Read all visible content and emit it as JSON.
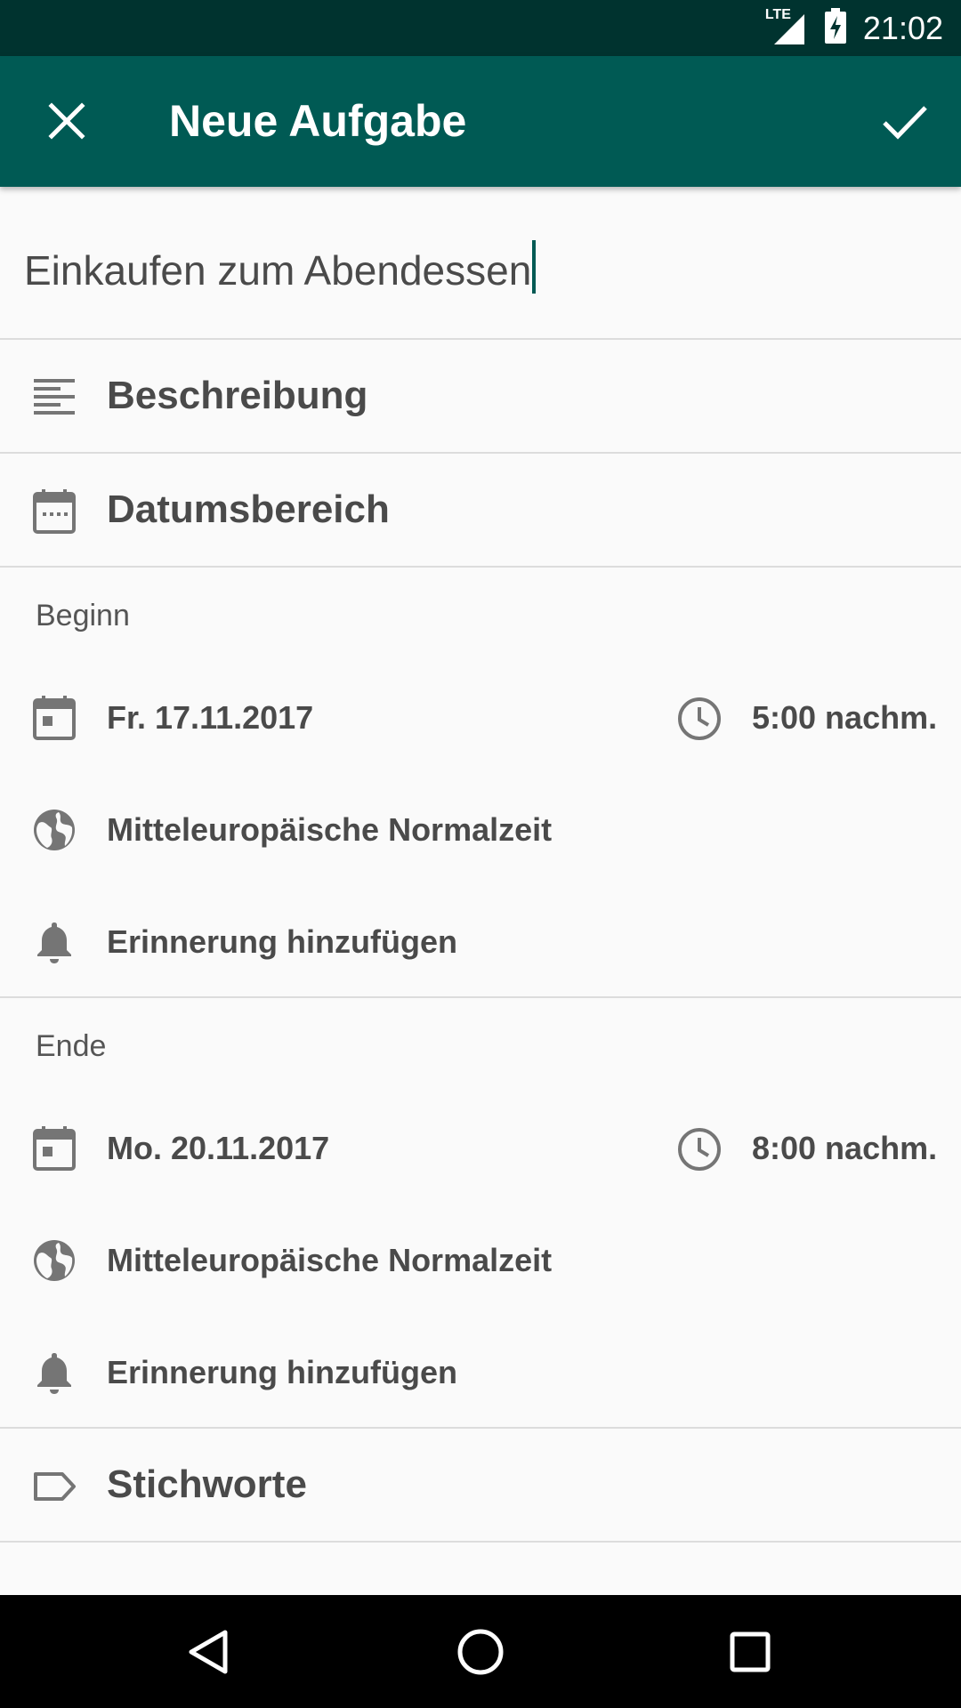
{
  "status_bar": {
    "network": "LTE",
    "time": "21:02"
  },
  "app_bar": {
    "title": "Neue Aufgabe",
    "close_icon": "close-icon",
    "confirm_icon": "check-icon"
  },
  "task": {
    "title_value": "Einkaufen zum Abendessen"
  },
  "sections": {
    "description": "Beschreibung",
    "date_range": "Datumsbereich",
    "tags": "Stichworte"
  },
  "begin": {
    "header": "Beginn",
    "date": "Fr. 17.11.2017",
    "time": "5:00 nachm.",
    "timezone": "Mitteleuropäische Normalzeit",
    "reminder": "Erinnerung hinzufügen"
  },
  "end": {
    "header": "Ende",
    "date": "Mo. 20.11.2017",
    "time": "8:00 nachm.",
    "timezone": "Mitteleuropäische Normalzeit",
    "reminder": "Erinnerung hinzufügen"
  },
  "colors": {
    "status_bar": "#00332f",
    "app_bar": "#005a54",
    "icon_gray": "#757575",
    "text": "#4a4a4a"
  }
}
